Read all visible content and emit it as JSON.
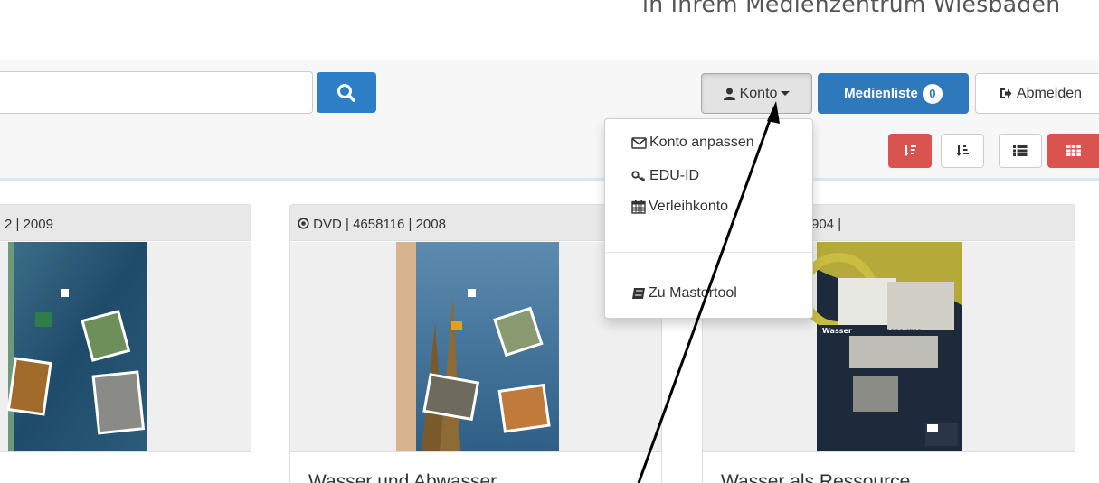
{
  "header": {
    "title": "in Ihrem Medienzentrum Wiesbaden"
  },
  "search": {
    "value": ""
  },
  "nav": {
    "konto_label": "Konto",
    "medienliste_label": "Medienliste",
    "medienliste_count": "0",
    "abmelden_label": "Abmelden"
  },
  "konto_menu": {
    "items": [
      {
        "label": "Konto anpassen",
        "icon": "envelope-icon"
      },
      {
        "label": "EDU-ID",
        "icon": "key-icon"
      },
      {
        "label": "Verleihkonto",
        "icon": "calendar-icon"
      },
      {
        "label": "Zu Mastertool",
        "icon": "book-icon"
      }
    ]
  },
  "toolbar": {
    "buttons": [
      "sort-descending-icon",
      "sort-ascending-icon",
      "list-view-icon",
      "grid-view-icon"
    ],
    "active_color": "#d9534f"
  },
  "cards": [
    {
      "meta": "2 | 2009",
      "title": ""
    },
    {
      "meta": "DVD | 4658116 | 2008",
      "title": "Wasser und Abwasser"
    },
    {
      "meta": "904 |",
      "title": "Wasser als Ressource"
    }
  ],
  "colors": {
    "primary": "#2e79bc",
    "danger": "#d9534f"
  }
}
